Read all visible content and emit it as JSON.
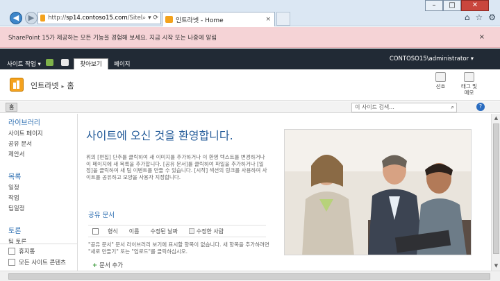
{
  "browser": {
    "address_prefix": "http://",
    "address_host": "sp14.contoso15.com",
    "address_suffix": "/Sitel",
    "tab_title": "인트라넷 - Home"
  },
  "notification": {
    "text": "SharePoint 15가 제공하는 모든 기능을 경험해 보세요. 지금 시작 또는 나중에 알림",
    "close": "×"
  },
  "suite": {
    "site_actions": "사이트 작업",
    "browse_tab": "찾아보기",
    "page_tab": "페이지",
    "user": "CONTOSO15\\administrator"
  },
  "header": {
    "site_title": "인트라넷",
    "breadcrumb_sep": "▸",
    "current": "홈",
    "prefs": "선호",
    "tags_line1": "태그 및",
    "tags_line2": "메모"
  },
  "topnav": {
    "home": "홈",
    "search_placeholder": "이 사이트 검색...",
    "help": "?"
  },
  "leftnav": {
    "libraries_heading": "라이브러리",
    "libraries": [
      "사이트 페이지",
      "공유 문서",
      "제안서"
    ],
    "lists_heading": "목록",
    "lists": [
      "일정",
      "작업",
      "팀일정"
    ],
    "discussions_heading": "토론",
    "discussions": [
      "팀 토론"
    ],
    "recycle_bin": "휴지통",
    "all_content": "모든 사이트 콘텐츠"
  },
  "main": {
    "welcome": "사이트에 오신 것을 환영합니다.",
    "intro": "위의 [편집] 단추를 클릭하여 새 이미지를 추가하거나 이 환영 텍스트를 변경하거나 이 페이지에 새 목록을 추가합니다. [공유 문서]를 클릭하여 파일을 추가하거나 [일정]을 클릭하여 새 팀 이벤트를 만들 수 있습니다. [시작] 섹션의 링크를 사용하여 사이트를 공유하고 모양을 사용자 지정합니다.",
    "doc_link": "공유 문서",
    "columns": [
      "형식",
      "이름",
      "수정된 날짜",
      "수정한 사람"
    ],
    "empty_message": "\"공유 문서\" 문서 라이브러리 보기에 표시할 항목이 없습니다. 새 항목을 추가하려면 \"새로 만들기\" 또는 \"업로드\"를 클릭하십시오.",
    "add_document": "문서 추가"
  }
}
